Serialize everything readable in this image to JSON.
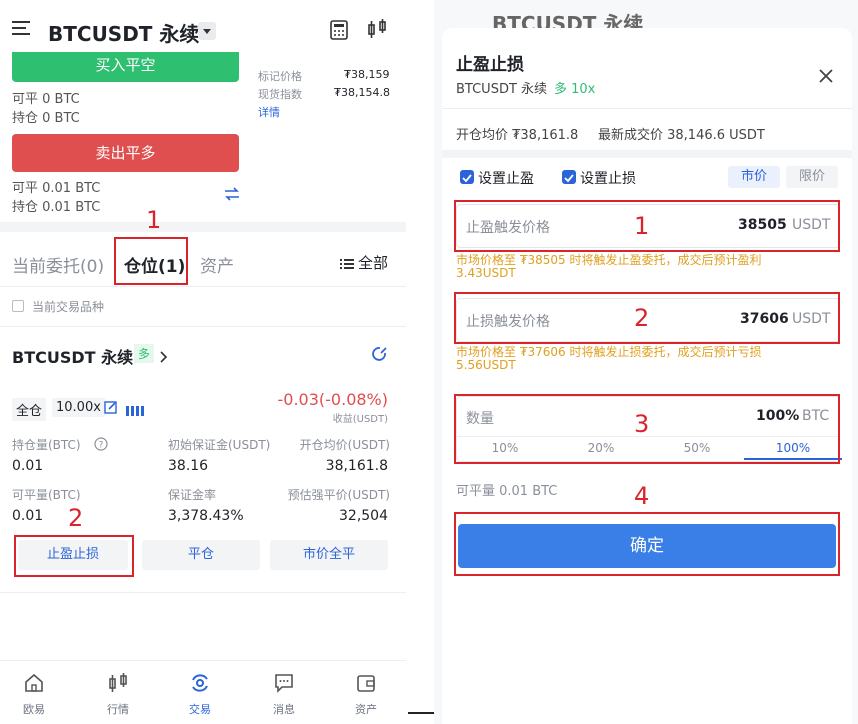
{
  "left": {
    "header": {
      "symbol": "BTCUSDT 永续"
    },
    "buy_button": "买入平空",
    "ticker": {
      "mark_label": "标记价格",
      "mark_value": "₮38,159",
      "index_label": "现货指数",
      "index_value": "₮38,154.8",
      "details": "详情"
    },
    "short_avail": "可平 0 BTC",
    "short_hold": "持仓 0 BTC",
    "sell_button": "卖出平多",
    "long_avail": "可平 0.01 BTC",
    "long_hold": "持仓 0.01 BTC",
    "tabs": {
      "orders": "当前委托(0)",
      "positions": "仓位(1)",
      "assets": "资产",
      "filter": "全部"
    },
    "current_symbol_only": "当前交易品种",
    "position": {
      "title": "BTCUSDT 永续",
      "direction": "多",
      "margin_mode": "全仓",
      "leverage": "10.00x",
      "pnl": "-0.03(-0.08%)",
      "pnl_label": "收益(USDT)",
      "size_label": "持仓量(BTC)",
      "size": "0.01",
      "init_margin_label": "初始保证金(USDT)",
      "init_margin": "38.16",
      "entry_label": "开仓均价(USDT)",
      "entry": "38,161.8",
      "closable_label": "可平量(BTC)",
      "closable": "0.01",
      "margin_ratio_label": "保证金率",
      "margin_ratio": "3,378.43%",
      "liq_label": "预估强平价(USDT)",
      "liq": "32,504",
      "tpsl_button": "止盈止损",
      "close_button": "平仓",
      "market_close_button": "市价全平"
    },
    "nav": [
      "欧易",
      "行情",
      "交易",
      "消息",
      "资产"
    ],
    "annotations": [
      "1",
      "2"
    ]
  },
  "right": {
    "bg_header": "BTCUSDT 永续",
    "title": "止盈止损",
    "subtitle_symbol": "BTCUSDT 永续",
    "subtitle_dir": "多 10x",
    "entry_info": "开仓均价 ₮38,161.8",
    "last_info": "最新成交价 38,146.6 USDT",
    "set_tp": "设置止盈",
    "set_sl": "设置止损",
    "market": "市价",
    "limit": "限价",
    "tp_label": "止盈触发价格",
    "tp_value": "38505",
    "tp_unit": "USDT",
    "tp_hint": "市场价格至 ₮38505 时将触发止盈委托，成交后预计盈利 3.43USDT",
    "sl_label": "止损触发价格",
    "sl_value": "37606",
    "sl_unit": "USDT",
    "sl_hint": "市场价格至 ₮37606 时将触发止损委托，成交后预计亏损 5.56USDT",
    "qty_label": "数量",
    "qty_value": "100%",
    "qty_unit": "BTC",
    "pct": [
      "10%",
      "20%",
      "50%",
      "100%"
    ],
    "available": "可平量 0.01 BTC",
    "confirm": "确定",
    "annotations": [
      "1",
      "2",
      "3",
      "4"
    ]
  },
  "colors": {
    "green": "#2fbf71",
    "red": "#e04f4f",
    "blue": "#3a7ee8",
    "annotation": "#d8242a",
    "warning": "#e0a020"
  }
}
